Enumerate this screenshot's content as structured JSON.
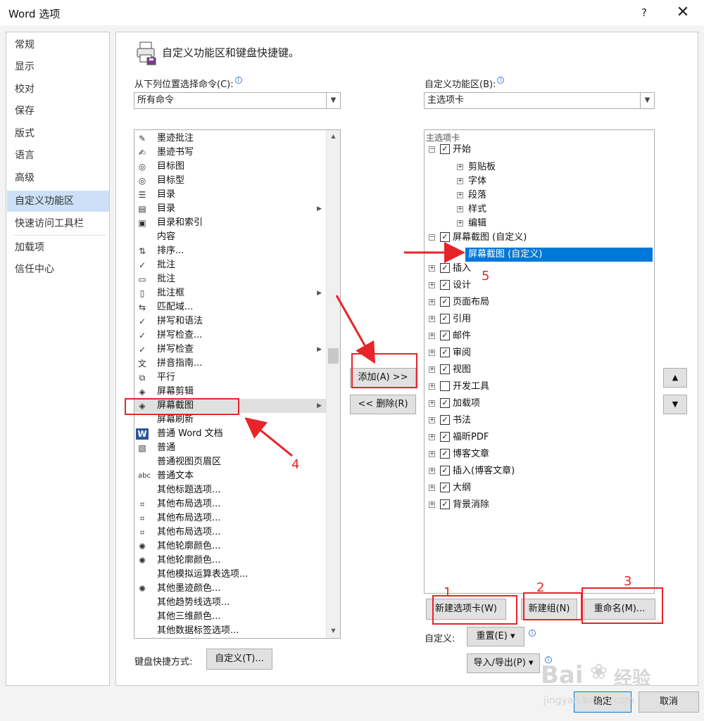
{
  "window": {
    "title": "Word 选项",
    "help_label": "?",
    "close_label": "✕"
  },
  "nav": {
    "items": [
      {
        "label": "常规"
      },
      {
        "label": "显示"
      },
      {
        "label": "校对"
      },
      {
        "label": "保存"
      },
      {
        "label": "版式"
      },
      {
        "label": "语言"
      },
      {
        "label": "高级"
      },
      {
        "label": "自定义功能区",
        "selected": true
      },
      {
        "label": "快速访问工具栏"
      },
      {
        "label": "加载项"
      },
      {
        "label": "信任中心"
      }
    ]
  },
  "header": {
    "title": "自定义功能区和键盘快捷键。"
  },
  "left": {
    "label": "从下列位置选择命令(C):",
    "combo_value": "所有命令",
    "commands": [
      {
        "label": "墨迹批注",
        "icon": "ink-annotate-icon",
        "glyph": "✎"
      },
      {
        "label": "墨迹书写",
        "icon": "ink-write-icon",
        "glyph": "✍"
      },
      {
        "label": "目标图",
        "icon": "target-icon",
        "glyph": "◎"
      },
      {
        "label": "目标型",
        "icon": "target-icon",
        "glyph": "◎"
      },
      {
        "label": "目录",
        "icon": "toc-icon",
        "glyph": "☰"
      },
      {
        "label": "目录",
        "icon": "toc-doc-icon",
        "glyph": "▤",
        "submenu": true
      },
      {
        "label": "目录和索引",
        "icon": "toc-index-icon",
        "glyph": "▣"
      },
      {
        "label": "内容",
        "icon": "",
        "glyph": ""
      },
      {
        "label": "排序...",
        "icon": "sort-icon",
        "glyph": "⇅"
      },
      {
        "label": "批注",
        "icon": "check-icon",
        "glyph": "✓"
      },
      {
        "label": "批注",
        "icon": "comment-icon",
        "glyph": "▭"
      },
      {
        "label": "批注框",
        "icon": "comment-box-icon",
        "glyph": "▯",
        "submenu": true
      },
      {
        "label": "匹配域...",
        "icon": "match-field-icon",
        "glyph": "⇆"
      },
      {
        "label": "拼写和语法",
        "icon": "spell-grammar-icon",
        "glyph": "✓"
      },
      {
        "label": "拼写检查...",
        "icon": "spell-check-icon",
        "glyph": "✓"
      },
      {
        "label": "拼写检查",
        "icon": "spell-check-icon",
        "glyph": "✓",
        "submenu": true
      },
      {
        "label": "拼音指南...",
        "icon": "phonetic-guide-icon",
        "glyph": "文"
      },
      {
        "label": "平行",
        "icon": "parallel-icon",
        "glyph": "⧉"
      },
      {
        "label": "屏幕剪辑",
        "icon": "screen-clip-icon",
        "glyph": "◈"
      },
      {
        "label": "屏幕截图",
        "icon": "screenshot-icon",
        "glyph": "◈",
        "submenu": true,
        "selected": true
      },
      {
        "label": "屏幕刷新",
        "icon": "",
        "glyph": ""
      },
      {
        "label": "普通 Word 文档",
        "icon": "word-doc-icon",
        "glyph": "W"
      },
      {
        "label": "普通",
        "icon": "cube-icon",
        "glyph": "▧"
      },
      {
        "label": "普通视图页眉区",
        "icon": "",
        "glyph": ""
      },
      {
        "label": "普通文本",
        "icon": "abc-icon",
        "glyph": "abc"
      },
      {
        "label": "其他标题选项...",
        "icon": "",
        "glyph": ""
      },
      {
        "label": "其他布局选项...",
        "icon": "layout-icon",
        "glyph": "⌗"
      },
      {
        "label": "其他布局选项...",
        "icon": "layout-icon",
        "glyph": "⌗"
      },
      {
        "label": "其他布局选项...",
        "icon": "layout-icon",
        "glyph": "⌗"
      },
      {
        "label": "其他轮廓颜色...",
        "icon": "color-wheel-icon",
        "glyph": "✺"
      },
      {
        "label": "其他轮廓颜色...",
        "icon": "color-wheel-icon",
        "glyph": "✺"
      },
      {
        "label": "其他模拟运算表选项...",
        "icon": "",
        "glyph": ""
      },
      {
        "label": "其他墨迹颜色...",
        "icon": "color-wheel-icon",
        "glyph": "✺"
      },
      {
        "label": "其他趋势线选项...",
        "icon": "",
        "glyph": ""
      },
      {
        "label": "其他三维颜色...",
        "icon": "",
        "glyph": ""
      },
      {
        "label": "其他数据标签选项...",
        "icon": "",
        "glyph": ""
      }
    ],
    "scroll_fraction": 0.44
  },
  "middle": {
    "add_label": "添加(A) >>",
    "remove_label": "<< 删除(R)"
  },
  "right": {
    "label": "自定义功能区(B):",
    "combo_value": "主选项卡",
    "tree_header": "主选项卡",
    "nodes": [
      {
        "label": "开始",
        "level": 0,
        "expander": "⊟",
        "checked": true
      },
      {
        "label": "剪贴板",
        "level": 1,
        "expander": "⊞"
      },
      {
        "label": "字体",
        "level": 1,
        "expander": "⊞"
      },
      {
        "label": "段落",
        "level": 1,
        "expander": "⊞"
      },
      {
        "label": "样式",
        "level": 1,
        "expander": "⊞"
      },
      {
        "label": "编辑",
        "level": 1,
        "expander": "⊞"
      },
      {
        "label": "屏幕截图 (自定义)",
        "level": 0,
        "expander": "⊟",
        "checked": true
      },
      {
        "label": "屏幕截图 (自定义)",
        "level": 1,
        "selected": true
      },
      {
        "label": "插入",
        "level": 0,
        "expander": "⊞",
        "checked": true
      },
      {
        "label": "设计",
        "level": 0,
        "expander": "⊞",
        "checked": true
      },
      {
        "label": "页面布局",
        "level": 0,
        "expander": "⊞",
        "checked": true
      },
      {
        "label": "引用",
        "level": 0,
        "expander": "⊞",
        "checked": true
      },
      {
        "label": "邮件",
        "level": 0,
        "expander": "⊞",
        "checked": true
      },
      {
        "label": "审阅",
        "level": 0,
        "expander": "⊞",
        "checked": true
      },
      {
        "label": "视图",
        "level": 0,
        "expander": "⊞",
        "checked": true
      },
      {
        "label": "开发工具",
        "level": 0,
        "expander": "⊞",
        "checked": false
      },
      {
        "label": "加载项",
        "level": 0,
        "expander": "⊞",
        "checked": true
      },
      {
        "label": "书法",
        "level": 0,
        "expander": "⊞",
        "checked": true
      },
      {
        "label": "福昕PDF",
        "level": 0,
        "expander": "⊞",
        "checked": true
      },
      {
        "label": "博客文章",
        "level": 0,
        "expander": "⊞",
        "checked": true
      },
      {
        "label": "插入(博客文章)",
        "level": 0,
        "expander": "⊞",
        "checked": true
      },
      {
        "label": "大纲",
        "level": 0,
        "expander": "⊞",
        "checked": true
      },
      {
        "label": "背景消除",
        "level": 0,
        "expander": "⊞",
        "checked": true
      }
    ],
    "move_up_label": "▲",
    "move_down_label": "▼",
    "new_tab_label": "新建选项卡(W)",
    "new_group_label": "新建组(N)",
    "rename_label": "重命名(M)...",
    "customize_label": "自定义:",
    "reset_label": "重置(E) ▾",
    "import_export_label": "导入/导出(P) ▾"
  },
  "footer": {
    "keyboard_label": "键盘快捷方式:",
    "keyboard_button": "自定义(T)...",
    "ok_label": "确定",
    "cancel_label": "取消"
  },
  "annotations": {
    "numbers": [
      "1",
      "2",
      "3",
      "4",
      "5"
    ],
    "color": "#e8232a"
  },
  "watermark": {
    "brand": "Bai",
    "brand2": "经验",
    "url": "jingyan.baidu.com"
  },
  "colors": {
    "selection": "#0078d7",
    "nav_selected": "#cce0f7",
    "accent_info": "#3c7fd0"
  }
}
